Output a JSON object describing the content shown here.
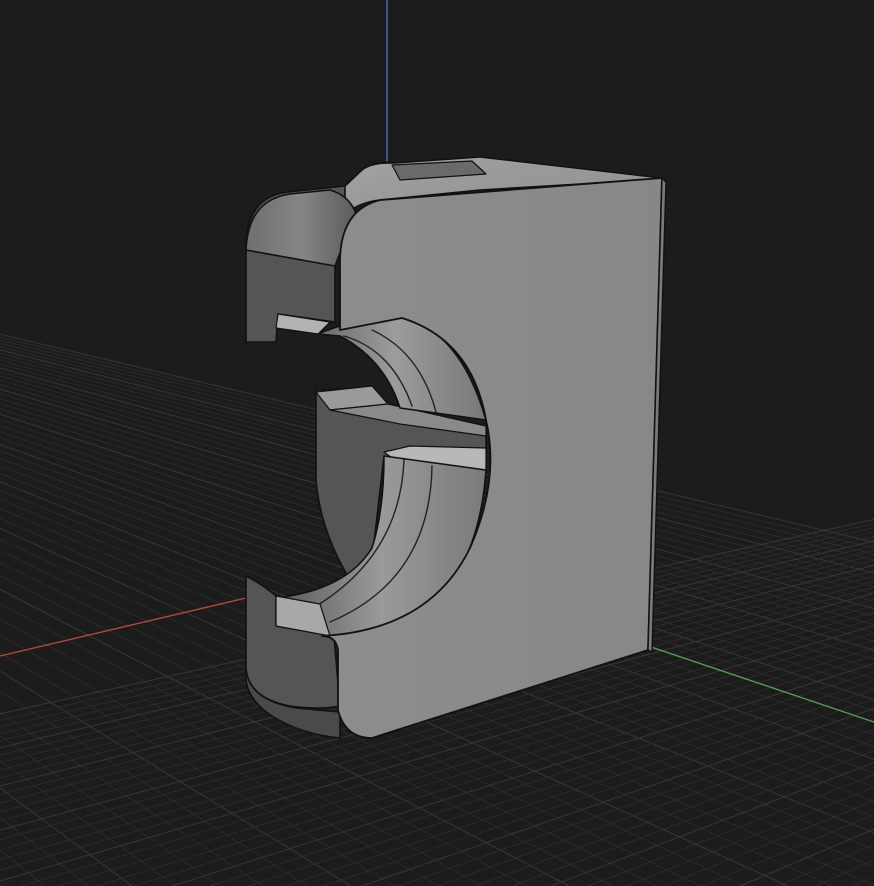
{
  "viewport": {
    "background": "#1c1c1c"
  },
  "grid": {
    "visible": true,
    "line_color": "#2e2e2e",
    "major_line_color": "#353535"
  },
  "axes": {
    "x_color": "#c0473f",
    "y_color": "#52a64f",
    "z_color": "#3f79d6"
  },
  "model": {
    "name": "slotted-clamp-block",
    "face_color": "#8e8e8e",
    "top_color": "#9a9a9a",
    "side_color": "#5a5a5a",
    "outline_color": "#111111"
  }
}
